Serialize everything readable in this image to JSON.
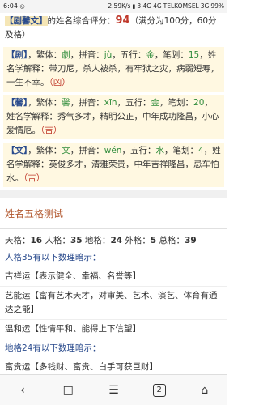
{
  "status": {
    "time": "6:04",
    "speed": "2.59K/s",
    "net1": "3 4G",
    "net2": "4G",
    "carrier": "TELKOMSEL",
    "net3": "3G",
    "battery": "99%"
  },
  "score": {
    "name": "剧馨文",
    "prefix": "【",
    "suffix": "】",
    "label": "的姓名综合评分：",
    "value": "94",
    "note": "（满分为100分，60分及格）"
  },
  "chars": [
    {
      "char": "剧",
      "trad_label": "，繁体：",
      "trad": "劇",
      "pinyin_label": "，拼音：",
      "pinyin": "jù",
      "wx_label": "，五行：",
      "wx": "金",
      "strokes_label": "，笔划：",
      "strokes": "15",
      "interp": "，姓名学解释：带刀尼，杀人被杀，有牢狱之灾，病弱短寿，一生不幸。",
      "verdict": "（凶）"
    },
    {
      "char": "馨",
      "trad_label": "，繁体：",
      "trad": "馨",
      "pinyin_label": "，拼音：",
      "pinyin": "xīn",
      "wx_label": "，五行：",
      "wx": "金",
      "strokes_label": "，笔划：",
      "strokes": "20",
      "interp": "，姓名学解释：秀气多才，精明公正，中年成功隆昌，小心爱情厄。",
      "verdict": "（吉）"
    },
    {
      "char": "文",
      "trad_label": "，繁体：",
      "trad": "文",
      "pinyin_label": "，拼音：",
      "pinyin": "wén",
      "wx_label": "，五行：",
      "wx": "水",
      "strokes_label": "，笔划：",
      "strokes": "4",
      "interp": "，姓名学解释：英俊多才，清雅荣贵，中年吉祥隆昌，忌车怕水。",
      "verdict": "（吉）"
    }
  ],
  "section_title": "姓名五格测试",
  "ge": {
    "tian_label": "天格：",
    "tian": "16",
    "ren_label": " 人格：",
    "ren": "35",
    "di_label": " 地格：",
    "di": "24",
    "wai_label": " 外格：",
    "wai": "5",
    "zong_label": " 总格：",
    "zong": "39"
  },
  "lines": [
    {
      "text": "人格35有以下数理暗示：",
      "head": true
    },
    {
      "text": "吉祥运【表示健全、幸福、名誉等】",
      "head": false
    },
    {
      "text": "艺能运【富有艺术天才，对审美、艺术、演艺、体育有通达之能】",
      "head": false
    },
    {
      "text": "温和运【性情平和、能得上下信望】",
      "head": false
    },
    {
      "text": "地格24有以下数理暗示：",
      "head": true
    },
    {
      "text": "富贵运【多钱财、富贵、白手可获巨财】",
      "head": false
    },
    {
      "text": "吉祥运【表示健全、幸福、名誉等】",
      "head": false
    }
  ],
  "nav": {
    "back": "‹",
    "tabs": "2",
    "menu": "☰",
    "home": "⌂",
    "book": "□"
  }
}
